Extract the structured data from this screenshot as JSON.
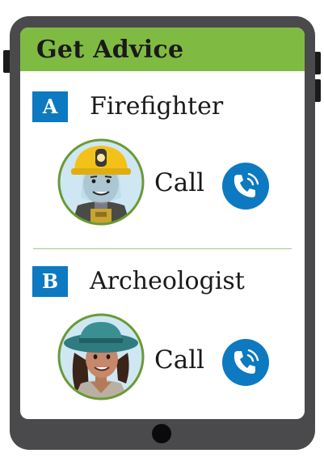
{
  "header": {
    "title": "Get Advice"
  },
  "options": [
    {
      "letter": "A",
      "title": "Firefighter",
      "call_label": "Call",
      "avatar_icon": "firefighter-avatar-icon"
    },
    {
      "letter": "B",
      "title": "Archeologist",
      "call_label": "Call",
      "avatar_icon": "archeologist-avatar-icon"
    }
  ],
  "colors": {
    "header_bg": "#7fba42",
    "badge_bg": "#0d79c0",
    "call_button": "#0d79c0",
    "device_frame": "#4a4a4c",
    "avatar_ring": "#6a9a34"
  },
  "icons": [
    "phone-call-icon",
    "home-button-icon"
  ]
}
